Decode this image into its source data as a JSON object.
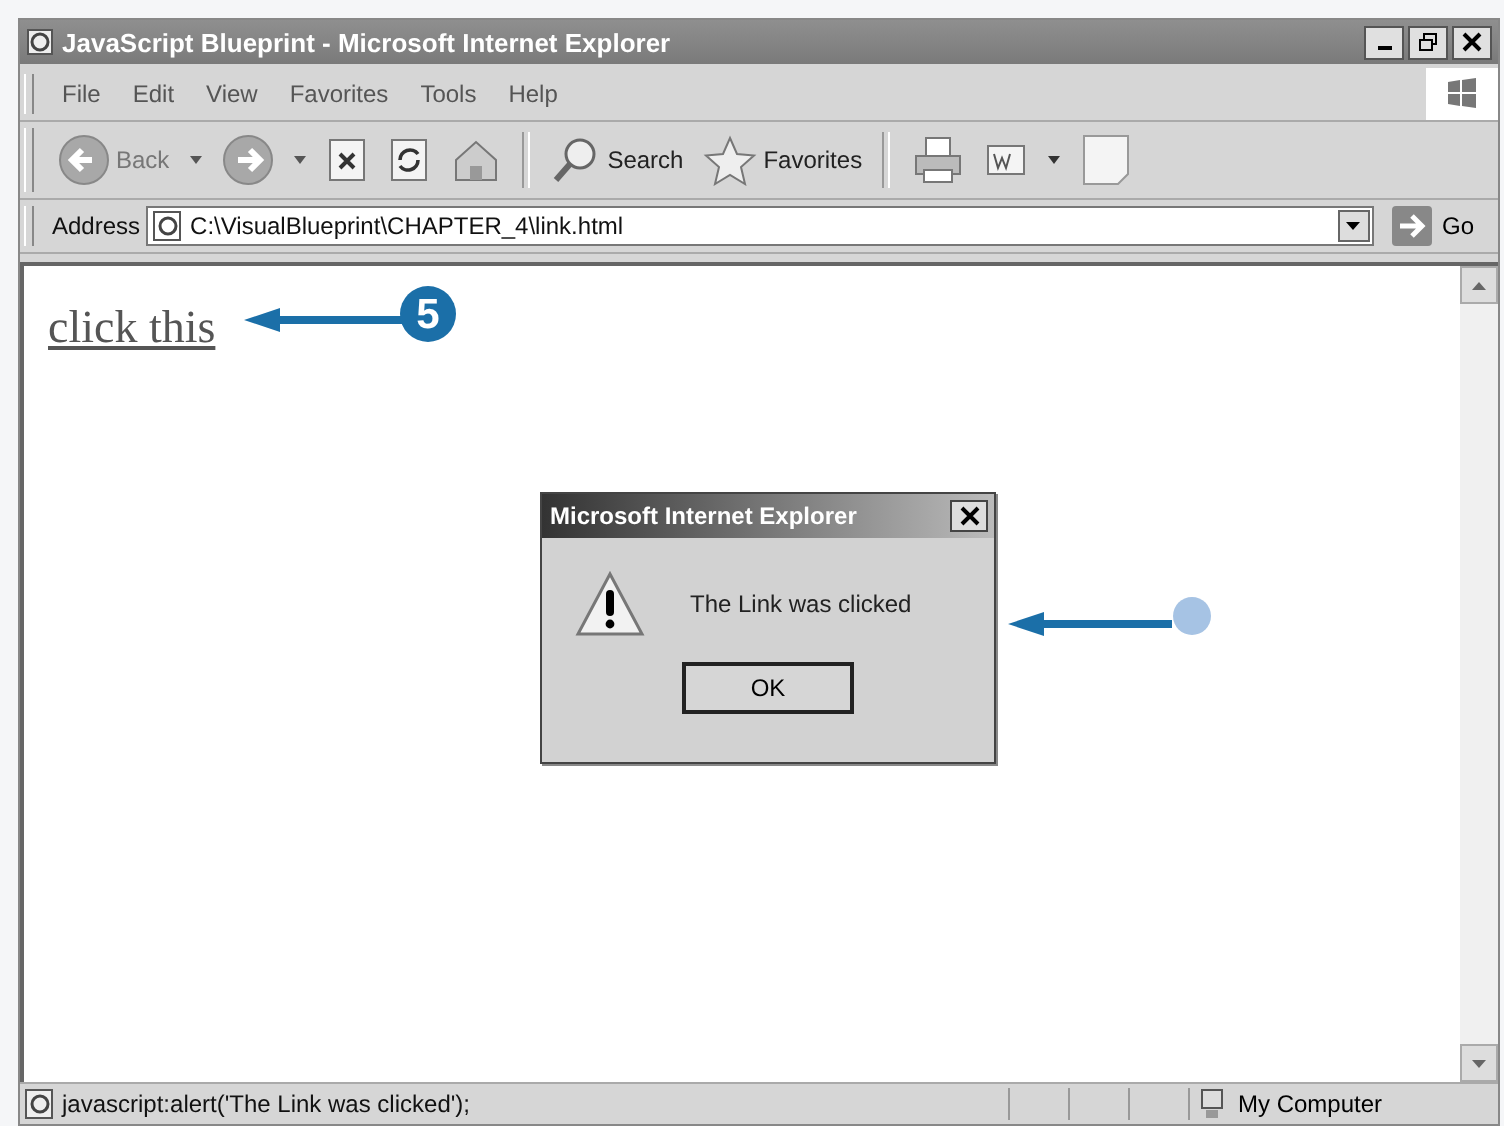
{
  "window": {
    "title": "JavaScript Blueprint - Microsoft Internet Explorer"
  },
  "menu": [
    "File",
    "Edit",
    "View",
    "Favorites",
    "Tools",
    "Help"
  ],
  "toolbar": {
    "back": "Back",
    "search": "Search",
    "favorites": "Favorites"
  },
  "address": {
    "label": "Address",
    "value": "C:\\VisualBlueprint\\CHAPTER_4\\link.html",
    "go": "Go"
  },
  "page": {
    "link": "click this"
  },
  "dialog": {
    "title": "Microsoft Internet Explorer",
    "message": "The Link was clicked",
    "button": "OK"
  },
  "callouts": [
    {
      "kind": "number",
      "label": "5"
    },
    {
      "kind": "dot"
    }
  ],
  "status_bar": {
    "text": "javascript:alert('The Link was clicked');",
    "zone": "My Computer"
  }
}
